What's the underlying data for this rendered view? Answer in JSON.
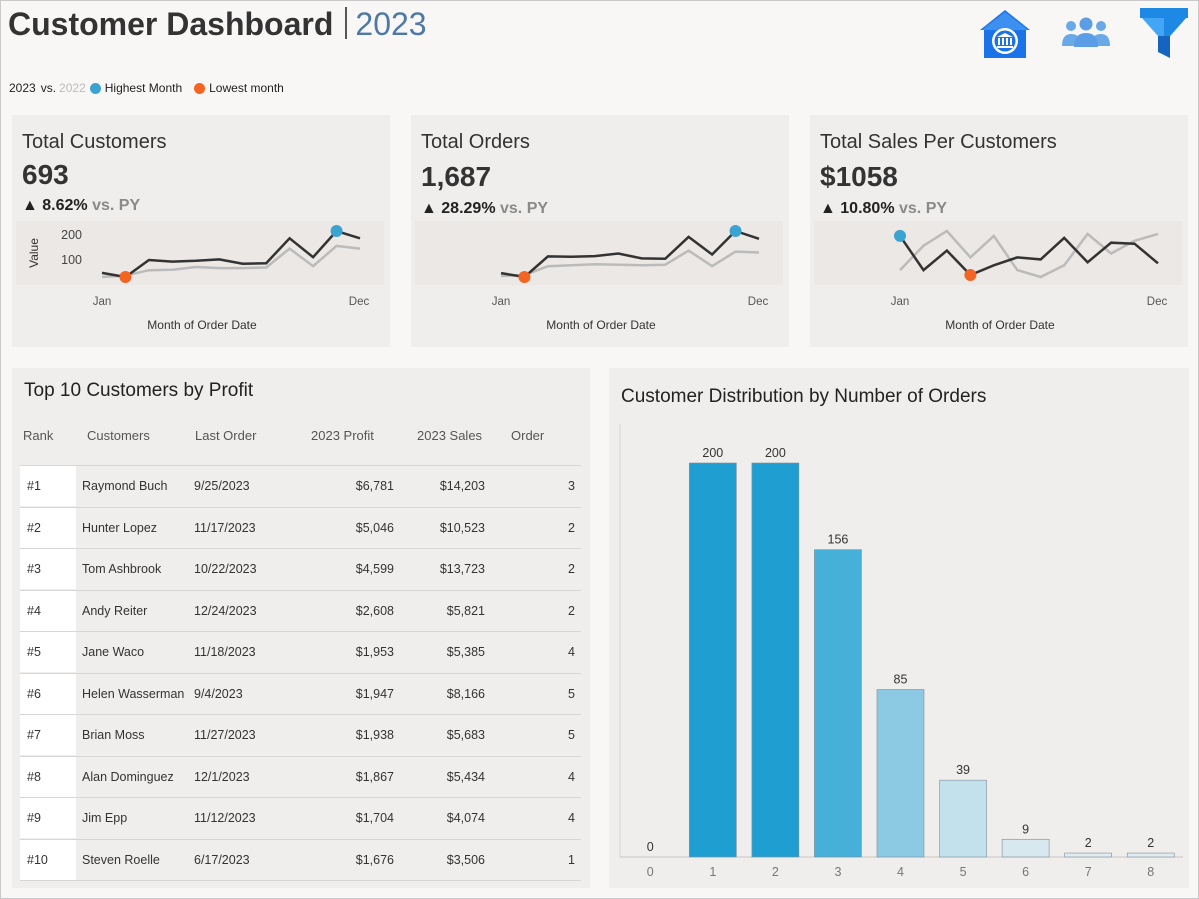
{
  "header": {
    "title": "Customer Dashboard",
    "year": "2023",
    "legend": {
      "current": "2023",
      "vs": "vs.",
      "prior": "2022",
      "highest": "Highest Month",
      "lowest": "Lowest month"
    },
    "icons": [
      "bank-icon",
      "users-icon",
      "filter-icon"
    ]
  },
  "colors": {
    "accent": "#4e79a7",
    "highest": "#3ba3d0",
    "lowest": "#f26522",
    "current_line": "#333333",
    "prior_line": "#bbbbbb"
  },
  "kpis": [
    {
      "title": "Total Customers",
      "value": "693",
      "delta": "▲ 8.62%",
      "vs": "vs. PY",
      "ylabel": "Value",
      "yticks": [
        "200",
        "100"
      ],
      "xstart": "Jan",
      "xend": "Dec",
      "xlabel": "Month of Order Date",
      "current": [
        70,
        55,
        118,
        112,
        115,
        120,
        104,
        106,
        198,
        128,
        225,
        198
      ],
      "prior": [
        55,
        60,
        80,
        82,
        92,
        88,
        88,
        90,
        160,
        95,
        170,
        160
      ]
    },
    {
      "title": "Total Orders",
      "value": "1,687",
      "delta": "▲ 28.29%",
      "vs": "vs. PY",
      "ylabel": "",
      "yticks": [],
      "xstart": "Jan",
      "xend": "Dec",
      "xlabel": "Month of Order Date",
      "current": [
        95,
        75,
        180,
        178,
        182,
        195,
        170,
        168,
        280,
        190,
        310,
        270
      ],
      "prior": [
        80,
        85,
        130,
        135,
        140,
        138,
        135,
        138,
        210,
        130,
        205,
        200
      ]
    },
    {
      "title": "Total Sales Per Customers",
      "value": "$1058",
      "delta": "▲ 10.80%",
      "vs": "vs. PY",
      "ylabel": "",
      "yticks": [],
      "xstart": "Jan",
      "xend": "Dec",
      "xlabel": "Month of Order Date",
      "current": [
        1300,
        950,
        1150,
        900,
        1000,
        1080,
        1060,
        1280,
        1030,
        1230,
        1220,
        1020
      ],
      "prior": [
        950,
        1200,
        1350,
        1080,
        1300,
        950,
        880,
        1000,
        1320,
        1120,
        1250,
        1320
      ]
    }
  ],
  "top_customers": {
    "title": "Top 10 Customers by Profit",
    "headers": {
      "rank": "Rank",
      "customer": "Customers",
      "last_order": "Last Order",
      "profit": "2023 Profit",
      "sales": "2023 Sales",
      "orders": "Order"
    },
    "rows": [
      {
        "rank": "#1",
        "customer": "Raymond Buch",
        "last_order": "9/25/2023",
        "profit": "$6,781",
        "sales": "$14,203",
        "orders": "3"
      },
      {
        "rank": "#2",
        "customer": "Hunter Lopez",
        "last_order": "11/17/2023",
        "profit": "$5,046",
        "sales": "$10,523",
        "orders": "2"
      },
      {
        "rank": "#3",
        "customer": "Tom Ashbrook",
        "last_order": "10/22/2023",
        "profit": "$4,599",
        "sales": "$13,723",
        "orders": "2"
      },
      {
        "rank": "#4",
        "customer": "Andy Reiter",
        "last_order": "12/24/2023",
        "profit": "$2,608",
        "sales": "$5,821",
        "orders": "2"
      },
      {
        "rank": "#5",
        "customer": "Jane Waco",
        "last_order": "11/18/2023",
        "profit": "$1,953",
        "sales": "$5,385",
        "orders": "4"
      },
      {
        "rank": "#6",
        "customer": "Helen Wasserman",
        "last_order": "9/4/2023",
        "profit": "$1,947",
        "sales": "$8,166",
        "orders": "5"
      },
      {
        "rank": "#7",
        "customer": "Brian Moss",
        "last_order": "11/27/2023",
        "profit": "$1,938",
        "sales": "$5,683",
        "orders": "5"
      },
      {
        "rank": "#8",
        "customer": "Alan Dominguez",
        "last_order": "12/1/2023",
        "profit": "$1,867",
        "sales": "$5,434",
        "orders": "4"
      },
      {
        "rank": "#9",
        "customer": "Jim Epp",
        "last_order": "11/12/2023",
        "profit": "$1,704",
        "sales": "$4,074",
        "orders": "4"
      },
      {
        "rank": "#10",
        "customer": "Steven Roelle",
        "last_order": "6/17/2023",
        "profit": "$1,676",
        "sales": "$3,506",
        "orders": "1"
      }
    ]
  },
  "chart_data": {
    "type": "bar",
    "title": "Customer Distribution by Number of Orders",
    "categories": [
      "0",
      "1",
      "2",
      "3",
      "4",
      "5",
      "6",
      "7",
      "8"
    ],
    "values": [
      0,
      200,
      200,
      156,
      85,
      39,
      9,
      2,
      2
    ],
    "xlabel": "",
    "ylabel": "",
    "ylim": [
      0,
      200
    ],
    "grid": false,
    "colors": [
      "#1f9fd1",
      "#1f9fd1",
      "#1f9fd1",
      "#46b0d9",
      "#8ccae3",
      "#c3e1ec",
      "#d8e8ef",
      "#e2ecf0",
      "#e2ecf0"
    ]
  }
}
